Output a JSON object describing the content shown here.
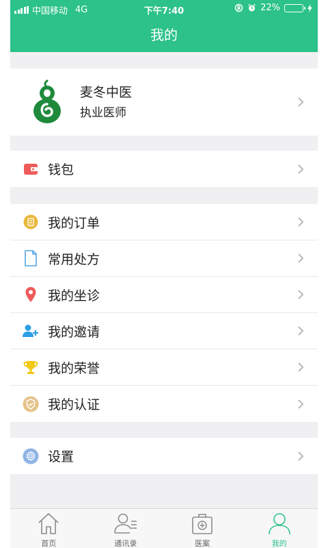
{
  "status_bar": {
    "carrier": "中国移动",
    "network": "4G",
    "time": "下午7:40",
    "battery_percent": "22%",
    "battery_level": 0.22
  },
  "header": {
    "title": "我的"
  },
  "profile": {
    "name": "麦冬中医",
    "title": "执业医师",
    "logo_icon": "gourd-logo-icon"
  },
  "wallet": {
    "label": "钱包",
    "icon": "wallet-icon"
  },
  "menu": [
    {
      "label": "我的订单",
      "icon": "order-icon"
    },
    {
      "label": "常用处方",
      "icon": "document-icon"
    },
    {
      "label": "我的坐诊",
      "icon": "location-pin-icon"
    },
    {
      "label": "我的邀请",
      "icon": "add-user-icon"
    },
    {
      "label": "我的荣誉",
      "icon": "trophy-icon"
    },
    {
      "label": "我的认证",
      "icon": "shield-check-icon"
    }
  ],
  "settings": {
    "label": "设置",
    "icon": "gear-icon"
  },
  "tabbar": {
    "items": [
      {
        "label": "首页",
        "icon": "home-icon"
      },
      {
        "label": "通讯录",
        "icon": "contacts-icon"
      },
      {
        "label": "医案",
        "icon": "medical-kit-icon"
      },
      {
        "label": "我的",
        "icon": "user-icon"
      }
    ],
    "active_index": 3
  },
  "colors": {
    "brand_green": "#2cc289",
    "wallet_red": "#ef5b5b",
    "order_yellow": "#e9b83b",
    "document_blue": "#4fa3e0",
    "pin_red": "#ef5b5b",
    "invite_blue": "#2e9fe6",
    "trophy_yellow": "#f2c811",
    "shield_tan": "#e5c38b",
    "gear_blue": "#8fb4e6"
  }
}
